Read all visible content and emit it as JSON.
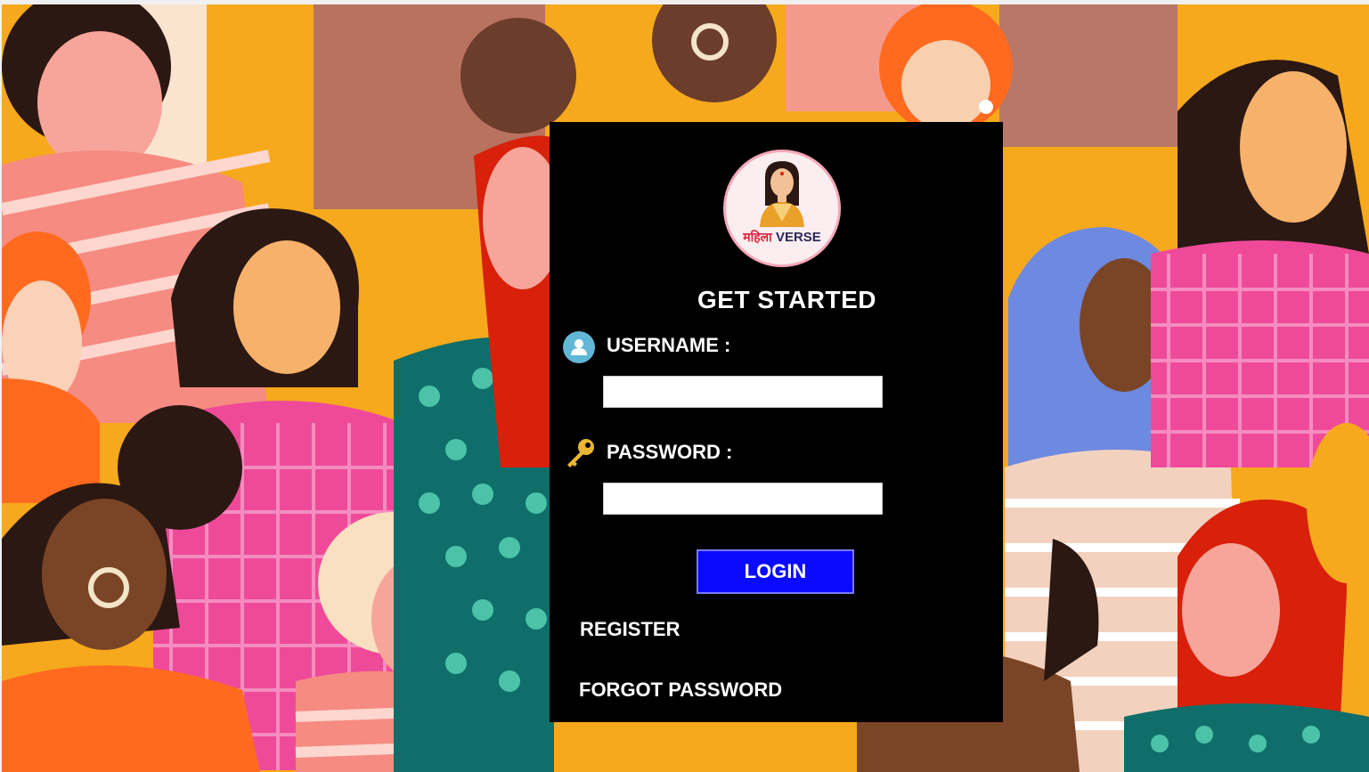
{
  "logo": {
    "hindi_text": "महिला",
    "latin_text": "VERSE"
  },
  "form": {
    "title": "GET STARTED",
    "username_label": "USERNAME :",
    "username_value": "",
    "password_label": "PASSWORD :",
    "password_value": "",
    "login_label": "LOGIN",
    "register_label": "REGISTER",
    "forgot_label": "FORGOT PASSWORD"
  },
  "icons": {
    "username": "user-icon",
    "password": "key-icon"
  },
  "colors": {
    "panel": "#000000",
    "login_button": "#0a0aff",
    "text": "#ffffff",
    "user_icon": "#62b7d6",
    "key_icon": "#e9b534",
    "logo_accent": "#e0243c"
  }
}
